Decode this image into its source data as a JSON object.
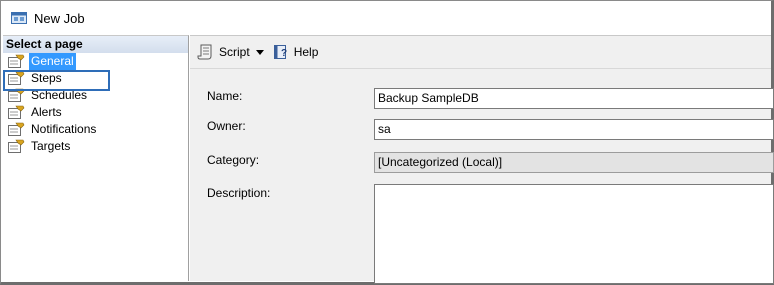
{
  "window": {
    "title": "New Job"
  },
  "sidebar": {
    "header": "Select a page",
    "items": [
      {
        "label": "General",
        "selected": true
      },
      {
        "label": "Steps",
        "selected": false
      },
      {
        "label": "Schedules",
        "selected": false
      },
      {
        "label": "Alerts",
        "selected": false
      },
      {
        "label": "Notifications",
        "selected": false
      },
      {
        "label": "Targets",
        "selected": false
      }
    ]
  },
  "toolbar": {
    "script_label": "Script",
    "help_label": "Help"
  },
  "form": {
    "name_label": "Name:",
    "name_value": "Backup SampleDB",
    "owner_label": "Owner:",
    "owner_value": "sa",
    "category_label": "Category:",
    "category_value": "[Uncategorized (Local)]",
    "description_label": "Description:",
    "description_value": ""
  },
  "colors": {
    "selection": "#3399ff",
    "highlight_border": "#2e6db8",
    "panel_bg": "#f0f0f0"
  }
}
